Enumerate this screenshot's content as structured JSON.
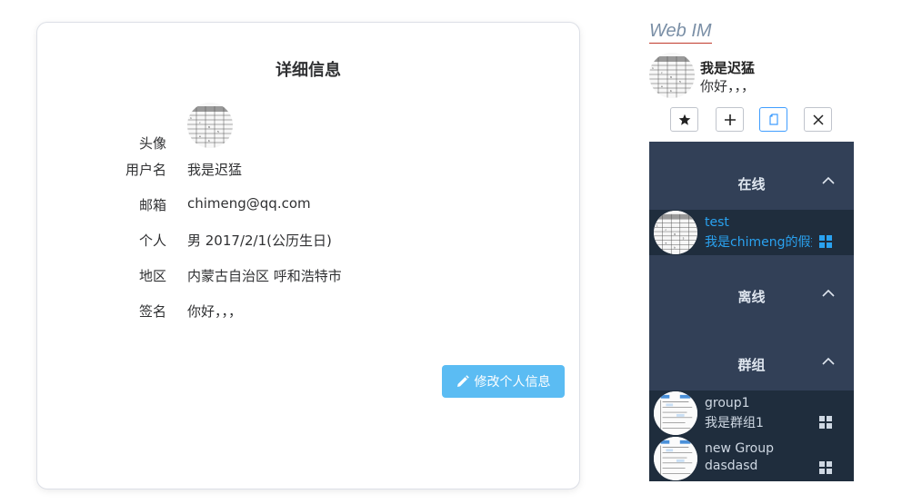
{
  "detail": {
    "title": "详细信息",
    "fields": [
      {
        "label": "头像",
        "value": ""
      },
      {
        "label": "用户名",
        "value": "我是迟猛"
      },
      {
        "label": "邮箱",
        "value": "chimeng@qq.com"
      },
      {
        "label": "个人",
        "value": "男 2017/2/1(公历生日)"
      },
      {
        "label": "地区",
        "value": "内蒙古自治区 呼和浩特市"
      },
      {
        "label": "签名",
        "value": "你好，，，"
      }
    ],
    "edit_button": "修改个人信息"
  },
  "im": {
    "title": "Web IM",
    "me": {
      "name": "我是迟猛",
      "signature": "你好，，，"
    },
    "toolbar": [
      "star-icon",
      "plus-icon",
      "copy-icon",
      "close-icon"
    ],
    "groups": [
      {
        "name": "在线",
        "items": [
          {
            "name": "test",
            "sign": "我是chimeng的假好友"
          }
        ]
      },
      {
        "name": "离线",
        "items": []
      },
      {
        "name": "群组",
        "items": [
          {
            "name": "group1",
            "sign": "我是群组1"
          },
          {
            "name": "new Group",
            "sign": "dasdasd"
          }
        ]
      }
    ]
  },
  "colors": {
    "accent": "#5bbcf3",
    "panel": "#324057",
    "panel_item": "#1f2d3d",
    "online_text": "#2aa2f0"
  }
}
